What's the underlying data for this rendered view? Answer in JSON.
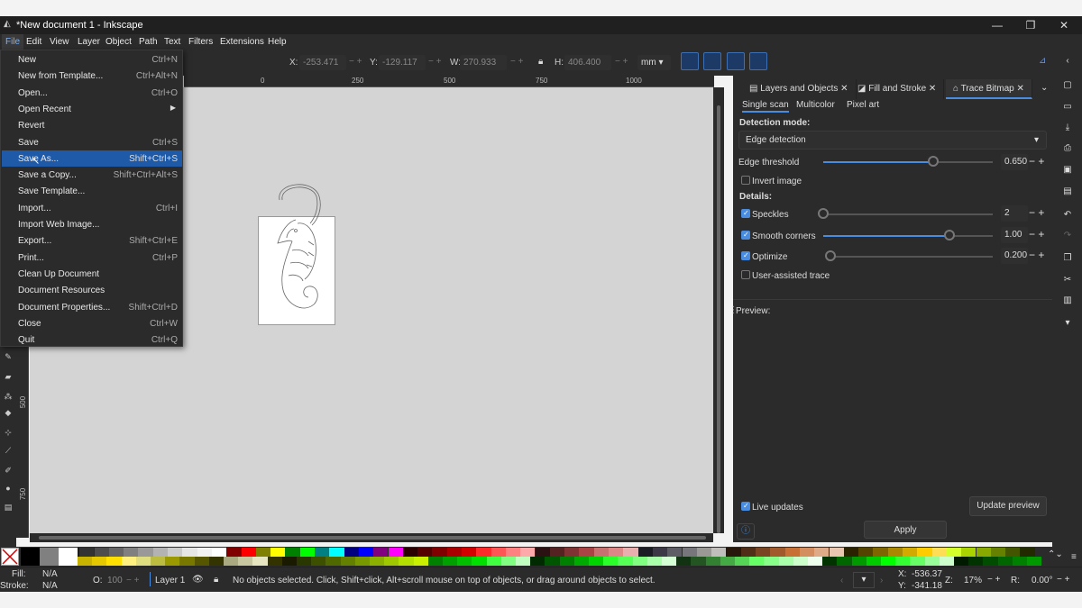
{
  "window": {
    "title": "*New document 1 - Inkscape",
    "minimize": "—",
    "maximize": "❐",
    "close": "✕"
  },
  "menubar": [
    "File",
    "Edit",
    "View",
    "Layer",
    "Object",
    "Path",
    "Text",
    "Filters",
    "Extensions",
    "Help"
  ],
  "toolbar": {
    "x_label": "X:",
    "x_value": "-253.471",
    "y_label": "Y:",
    "y_value": "-129.117",
    "w_label": "W:",
    "w_value": "270.933",
    "h_label": "H:",
    "h_value": "406.400",
    "unit": "mm"
  },
  "ruler": {
    "h": [
      "0",
      "250",
      "500",
      "750",
      "1000"
    ],
    "v": [
      "500",
      "750"
    ]
  },
  "file_menu": [
    {
      "label": "New",
      "shortcut": "Ctrl+N"
    },
    {
      "label": "New from Template...",
      "shortcut": "Ctrl+Alt+N"
    },
    {
      "label": "Open...",
      "shortcut": "Ctrl+O"
    },
    {
      "label": "Open Recent",
      "shortcut": ""
    },
    {
      "label": "Revert",
      "shortcut": ""
    },
    {
      "label": "Save",
      "shortcut": "Ctrl+S"
    },
    {
      "label": "Save As...",
      "shortcut": "Shift+Ctrl+S"
    },
    {
      "label": "Save a Copy...",
      "shortcut": "Shift+Ctrl+Alt+S"
    },
    {
      "label": "Save Template...",
      "shortcut": ""
    },
    {
      "label": "Import...",
      "shortcut": "Ctrl+I"
    },
    {
      "label": "Import Web Image...",
      "shortcut": ""
    },
    {
      "label": "Export...",
      "shortcut": "Shift+Ctrl+E"
    },
    {
      "label": "Print...",
      "shortcut": "Ctrl+P"
    },
    {
      "label": "Clean Up Document",
      "shortcut": ""
    },
    {
      "label": "Document Resources",
      "shortcut": ""
    },
    {
      "label": "Document Properties...",
      "shortcut": "Shift+Ctrl+D"
    },
    {
      "label": "Close",
      "shortcut": "Ctrl+W"
    },
    {
      "label": "Quit",
      "shortcut": "Ctrl+Q"
    }
  ],
  "dock": {
    "tabs": [
      "Layers and Objects",
      "Fill and Stroke",
      "Trace Bitmap"
    ],
    "subtabs": [
      "Single scan",
      "Multicolor",
      "Pixel art"
    ],
    "detection_mode_label": "Detection mode:",
    "detection_mode": "Edge detection",
    "edge_threshold_label": "Edge threshold",
    "edge_threshold": "0.650",
    "invert_image": "Invert image",
    "details_label": "Details:",
    "speckles_label": "Speckles",
    "speckles": "2",
    "smooth_corners_label": "Smooth corners",
    "smooth_corners": "1.00",
    "optimize_label": "Optimize",
    "optimize": "0.200",
    "user_assisted": "User-assisted trace",
    "preview_label": "Preview:",
    "live_updates": "Live updates",
    "update_preview": "Update preview",
    "apply": "Apply"
  },
  "status": {
    "fill_label": "Fill:",
    "fill_value": "N/A",
    "stroke_label": "Stroke:",
    "stroke_value": "N/A",
    "opacity_label": "O:",
    "opacity_value": "100",
    "layer": "Layer 1",
    "message": "No objects selected. Click, Shift+click, Alt+scroll mouse on top of objects, or drag around objects to select.",
    "x_label": "X:",
    "x_value": "-536.37",
    "y_label": "Y:",
    "y_value": "-341.18",
    "zoom_label": "Z:",
    "zoom": "17%",
    "rotation_label": "R:",
    "rotation": "0.00°"
  },
  "palette_top": [
    "#000000",
    "#808080",
    "#ffffff",
    "#1a1a1a",
    "#333333",
    "#4d4d4d",
    "#666666",
    "#808080",
    "#999999",
    "#b3b3b3",
    "#cccccc",
    "#e6e6e6",
    "#f2f2f2",
    "#ffffff",
    "#800000",
    "#ff0000",
    "#808000",
    "#ffff00",
    "#008000",
    "#00ff00",
    "#008080",
    "#00ffff",
    "#000080",
    "#0000ff",
    "#800080",
    "#ff00ff",
    "#2b0000",
    "#550000",
    "#800000",
    "#aa0000",
    "#d40000",
    "#ff2a2a",
    "#ff5555",
    "#ff8080",
    "#ffaaaa",
    "#2b1111",
    "#552222",
    "#803333",
    "#aa4444",
    "#c87171",
    "#de8787",
    "#e9afaf",
    "#1c1c24",
    "#3d3846",
    "#5e5c64",
    "#77767b",
    "#9a9996",
    "#c0bfbc",
    "#28170b",
    "#502d16",
    "#784421",
    "#a05a2c",
    "#c87137",
    "#d38d5f",
    "#deaa87",
    "#e9c6af",
    "#2b2200",
    "#554400",
    "#806600",
    "#aa8800",
    "#d4aa00",
    "#ffcc00",
    "#ffdd55",
    "#d4ff2a",
    "#aad400",
    "#88aa00",
    "#668000",
    "#445500",
    "#222b00"
  ],
  "palette_bottom": [
    "#c8b400",
    "#e6c800",
    "#ffe000",
    "#fff080",
    "#dede80",
    "#bcbc40",
    "#9a9a00",
    "#787800",
    "#565600",
    "#343400",
    "#aaaa80",
    "#c8c8a0",
    "#e6e6c0",
    "#333300",
    "#1a1a00",
    "#283800",
    "#3c5000",
    "#506800",
    "#648000",
    "#789800",
    "#8cb000",
    "#a0c800",
    "#b4e000",
    "#c8f000",
    "#008000",
    "#00a000",
    "#00c000",
    "#00e000",
    "#40ff40",
    "#80ff80",
    "#c0ffc0",
    "#002b00",
    "#005500",
    "#008000",
    "#00aa00",
    "#00d400",
    "#2aff2a",
    "#55ff55",
    "#80ff80",
    "#aaffaa",
    "#d5ffd5",
    "#113311",
    "#225522",
    "#338033",
    "#44aa44",
    "#55d455",
    "#66ff66",
    "#88ff88",
    "#aaffaa",
    "#ccffcc",
    "#eeffee",
    "#003300",
    "#006600",
    "#009900",
    "#00cc00",
    "#00ff00",
    "#33ff33",
    "#66ff66",
    "#99ff99",
    "#ccffcc",
    "#001a00",
    "#003300",
    "#004d00",
    "#006600",
    "#008000",
    "#009900"
  ]
}
